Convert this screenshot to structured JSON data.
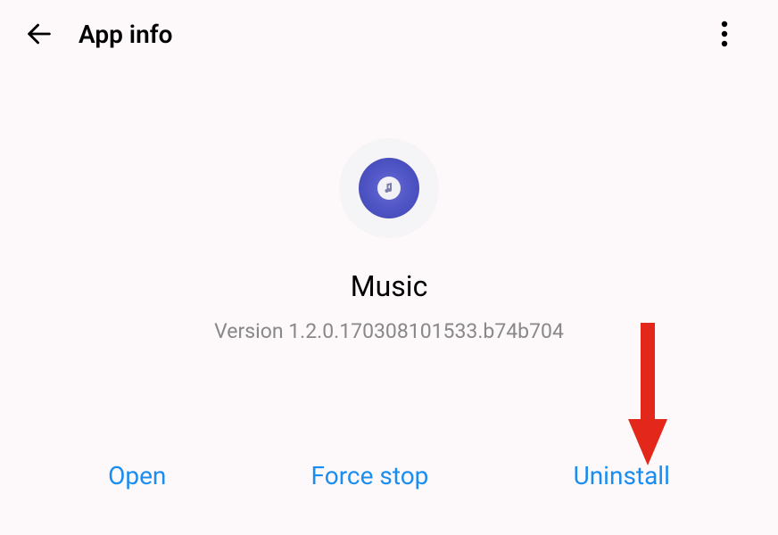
{
  "header": {
    "title": "App info"
  },
  "app": {
    "name": "Music",
    "version_label": "Version 1.2.0.170308101533.b74b704",
    "icon_name": "music-disc-icon"
  },
  "actions": {
    "open": "Open",
    "force_stop": "Force stop",
    "uninstall": "Uninstall"
  },
  "colors": {
    "accent": "#1a8ef0",
    "muted": "#888888",
    "arrow": "#E4271B"
  }
}
